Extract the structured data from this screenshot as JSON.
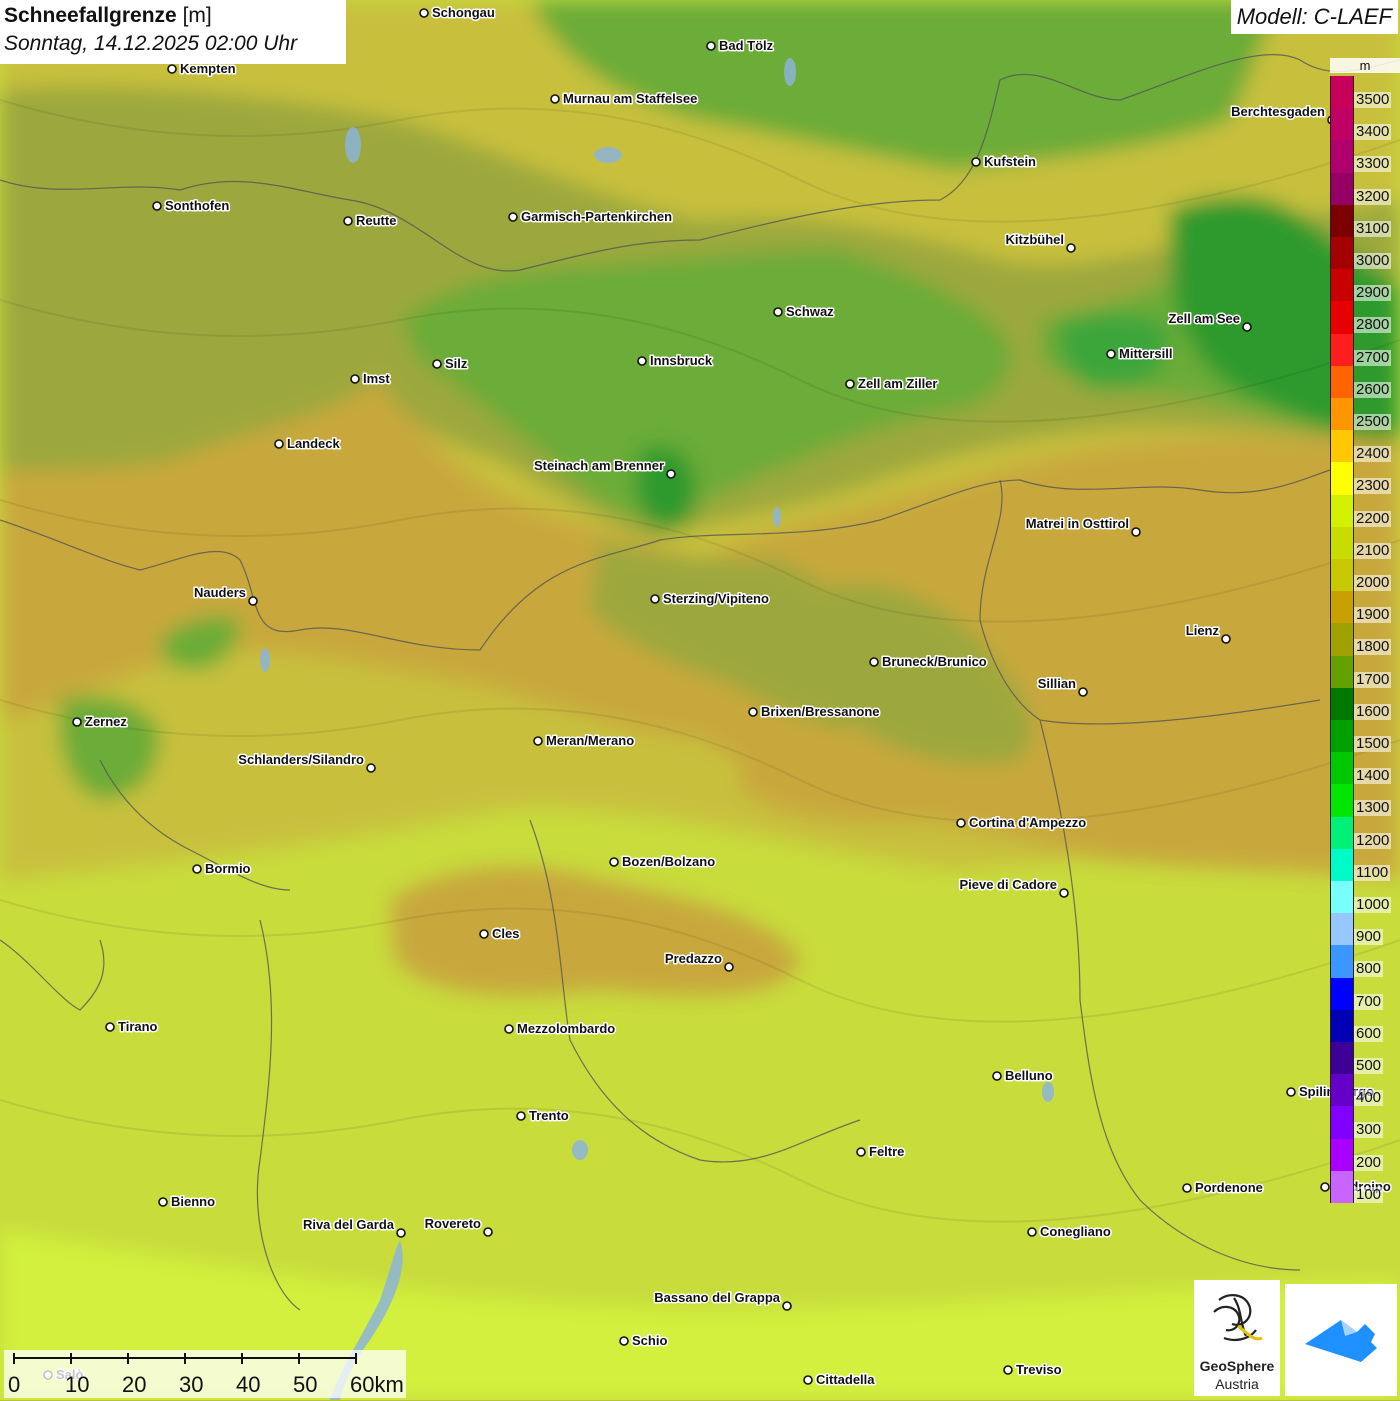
{
  "header": {
    "title": "Schneefallgrenze",
    "unit": "[m]",
    "datetime": "Sonntag, 14.12.2025 02:00 Uhr",
    "model": "Modell: C-LAEF"
  },
  "legend": {
    "unit": "m",
    "entries": [
      {
        "label": "3500",
        "color": "#c8005a"
      },
      {
        "label": "3400",
        "color": "#c00064"
      },
      {
        "label": "3300",
        "color": "#b0006e"
      },
      {
        "label": "3200",
        "color": "#960064"
      },
      {
        "label": "3100",
        "color": "#7d0000"
      },
      {
        "label": "3000",
        "color": "#a50000"
      },
      {
        "label": "2900",
        "color": "#c80000"
      },
      {
        "label": "2800",
        "color": "#e60000"
      },
      {
        "label": "2700",
        "color": "#ff1e1e"
      },
      {
        "label": "2600",
        "color": "#ff6400"
      },
      {
        "label": "2500",
        "color": "#ff9600"
      },
      {
        "label": "2400",
        "color": "#ffc800"
      },
      {
        "label": "2300",
        "color": "#ffff00"
      },
      {
        "label": "2200",
        "color": "#d2f000"
      },
      {
        "label": "2100",
        "color": "#c8dc00"
      },
      {
        "label": "2000",
        "color": "#c8c800"
      },
      {
        "label": "1900",
        "color": "#c8a000"
      },
      {
        "label": "1800",
        "color": "#a0a000"
      },
      {
        "label": "1700",
        "color": "#64a000"
      },
      {
        "label": "1600",
        "color": "#007800"
      },
      {
        "label": "1500",
        "color": "#00a000"
      },
      {
        "label": "1400",
        "color": "#00c800"
      },
      {
        "label": "1300",
        "color": "#00e600"
      },
      {
        "label": "1200",
        "color": "#00f078"
      },
      {
        "label": "1100",
        "color": "#00fac8"
      },
      {
        "label": "1000",
        "color": "#78ffff"
      },
      {
        "label": "900",
        "color": "#96c8ff"
      },
      {
        "label": "800",
        "color": "#3c96ff"
      },
      {
        "label": "700",
        "color": "#0000ff"
      },
      {
        "label": "600",
        "color": "#0000b4"
      },
      {
        "label": "500",
        "color": "#3c0096"
      },
      {
        "label": "400",
        "color": "#6400c8"
      },
      {
        "label": "300",
        "color": "#8200ff"
      },
      {
        "label": "200",
        "color": "#aa00ff"
      },
      {
        "label": "100",
        "color": "#c864ff"
      }
    ]
  },
  "cities": [
    {
      "name": "Schongau"
    },
    {
      "name": "Bad Tölz"
    },
    {
      "name": "Kempten"
    },
    {
      "name": "Murnau am Staffelsee"
    },
    {
      "name": "Berchtesgaden"
    },
    {
      "name": "Kufstein"
    },
    {
      "name": "Sonthofen"
    },
    {
      "name": "Reutte"
    },
    {
      "name": "Garmisch-Partenkirchen"
    },
    {
      "name": "Kitzbühel"
    },
    {
      "name": "Schwaz"
    },
    {
      "name": "Zell am See"
    },
    {
      "name": "Mittersill"
    },
    {
      "name": "Innsbruck"
    },
    {
      "name": "Imst"
    },
    {
      "name": "Silz"
    },
    {
      "name": "Zell am Ziller"
    },
    {
      "name": "Landeck"
    },
    {
      "name": "Steinach am Brenner"
    },
    {
      "name": "Matrei in Osttirol"
    },
    {
      "name": "Nauders"
    },
    {
      "name": "Sterzing/Vipiteno"
    },
    {
      "name": "Lienz"
    },
    {
      "name": "Bruneck/Brunico"
    },
    {
      "name": "Sillian"
    },
    {
      "name": "Brixen/Bressanone"
    },
    {
      "name": "Zernez"
    },
    {
      "name": "Meran/Merano"
    },
    {
      "name": "Schlanders/Silandro"
    },
    {
      "name": "Cortina d'Ampezzo"
    },
    {
      "name": "Bozen/Bolzano"
    },
    {
      "name": "Bormio"
    },
    {
      "name": "Pieve di Cadore"
    },
    {
      "name": "Cles"
    },
    {
      "name": "Predazzo"
    },
    {
      "name": "Tirano"
    },
    {
      "name": "Mezzolombardo"
    },
    {
      "name": "Belluno"
    },
    {
      "name": "Spilimbergo"
    },
    {
      "name": "Trento"
    },
    {
      "name": "Feltre"
    },
    {
      "name": "Pordenone"
    },
    {
      "name": "Codroipo"
    },
    {
      "name": "Bienno"
    },
    {
      "name": "Riva del Garda"
    },
    {
      "name": "Rovereto"
    },
    {
      "name": "Conegliano"
    },
    {
      "name": "Bassano del Grappa"
    },
    {
      "name": "Schio"
    },
    {
      "name": "Treviso"
    },
    {
      "name": "Cittadella"
    },
    {
      "name": "Salò"
    }
  ],
  "scalebar": {
    "ticks": [
      "0",
      "10",
      "20",
      "30",
      "40",
      "50",
      "60km"
    ]
  },
  "logos": {
    "geosphere": "GeoSphere",
    "austria": "Austria"
  }
}
